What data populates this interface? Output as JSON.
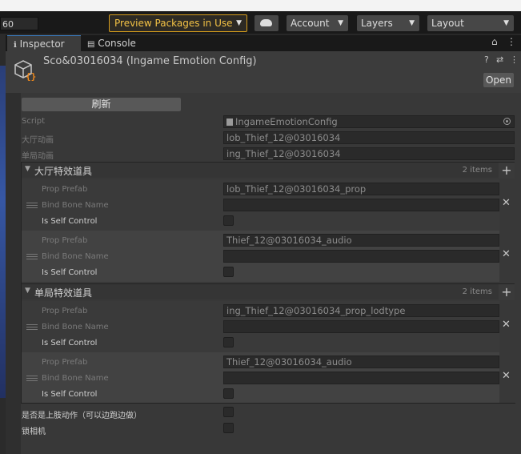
{
  "toolbar": {
    "frame_value": "60",
    "preview_label": "Preview Packages in Use",
    "account_label": "Account",
    "layers_label": "Layers",
    "layout_label": "Layout",
    "preview_color": "#d59c1c"
  },
  "tabs": [
    {
      "label": "Inspector",
      "icon": "info-icon",
      "active": true
    },
    {
      "label": "Console",
      "icon": "console-icon",
      "active": false
    }
  ],
  "header": {
    "title": "Sco&03016034 (Ingame Emotion Config)",
    "open_label": "Open"
  },
  "component": {
    "refresh_label": "刷新",
    "script_label": "Script",
    "script_value": "IngameEmotionConfig",
    "lobby_anim_label": "大厅动画",
    "lobby_anim_value": "lob_Thief_12@03016034",
    "ingame_anim_label": "单局动画",
    "ingame_anim_value": "ing_Thief_12@03016034"
  },
  "lists": [
    {
      "title": "大厅特效道具",
      "count": "2 items",
      "items": [
        {
          "prop_label": "Prop Prefab",
          "prop_value": "lob_Thief_12@03016034_prop",
          "bone_label": "Bind Bone Name",
          "bone_value": "",
          "self_label": "Is Self Control"
        },
        {
          "prop_label": "Prop Prefab",
          "prop_value": "Thief_12@03016034_audio",
          "bone_label": "Bind Bone Name",
          "bone_value": "",
          "self_label": "Is Self Control"
        }
      ]
    },
    {
      "title": "单局特效道具",
      "count": "2 items",
      "items": [
        {
          "prop_label": "Prop Prefab",
          "prop_value": "ing_Thief_12@03016034_prop_lodtype",
          "bone_label": "Bind Bone Name",
          "bone_value": "",
          "self_label": "Is Self Control"
        },
        {
          "prop_label": "Prop Prefab",
          "prop_value": "Thief_12@03016034_audio",
          "bone_label": "Bind Bone Name",
          "bone_value": "",
          "self_label": "Is Self Control"
        }
      ]
    }
  ],
  "footer": {
    "upper_body_label": "是否是上肢动作（可以边跑边做）",
    "lock_camera_label": "锁相机"
  }
}
